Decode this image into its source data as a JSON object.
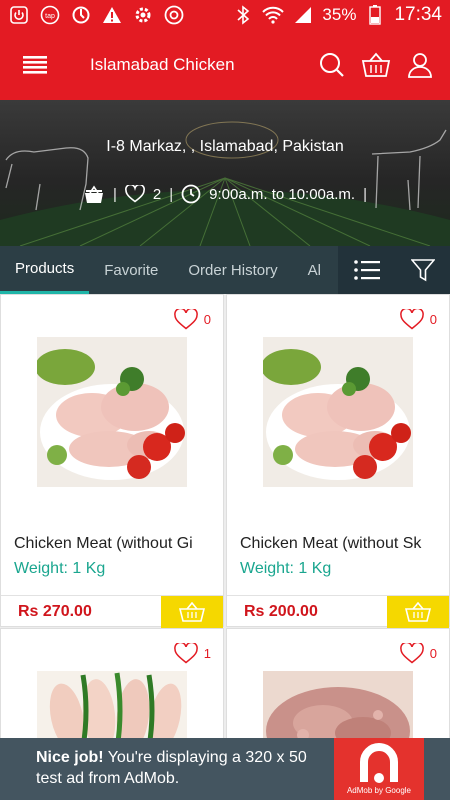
{
  "status_bar": {
    "battery": "35%",
    "time": "17:34",
    "icons": [
      "power-icon",
      "tap-icon",
      "sync-icon",
      "warning-icon",
      "cog-icon",
      "chrome-icon",
      "bluetooth-icon",
      "wifi-icon",
      "signal-icon",
      "battery-icon"
    ]
  },
  "app_bar": {
    "title": "Islamabad Chicken"
  },
  "store": {
    "address": "I-8 Markaz, , Islamabad, Pakistan",
    "likes": "2",
    "hours": "9:00a.m. to 10:00a.m."
  },
  "tabs": [
    {
      "label": "Products",
      "active": true
    },
    {
      "label": "Favorite",
      "active": false
    },
    {
      "label": "Order History",
      "active": false
    },
    {
      "label": "Al",
      "active": false
    }
  ],
  "products": [
    {
      "name": "Chicken Meat (without Gi",
      "weight": "Weight: 1 Kg",
      "price": "Rs 270.00",
      "favorites": "0",
      "image": "raw-chicken-thighs"
    },
    {
      "name": "Chicken Meat (without Sk",
      "weight": "Weight: 1 Kg",
      "price": "Rs 200.00",
      "favorites": "0",
      "image": "raw-chicken-thighs"
    },
    {
      "favorites": "1",
      "image": "chicken-breasts-with-chillies"
    },
    {
      "favorites": "0",
      "image": "minced-meat"
    }
  ],
  "ad": {
    "headline": "Nice job!",
    "body": "You're displaying a 320 x 50 test ad from AdMob.",
    "logo_caption": "AdMob by Google"
  },
  "colors": {
    "primary_red": "#e31b23",
    "tab_bar": "#2c3e45",
    "accent_green": "#1aa68f",
    "cart_yellow": "#f5d800",
    "ad_bg": "#445560"
  }
}
